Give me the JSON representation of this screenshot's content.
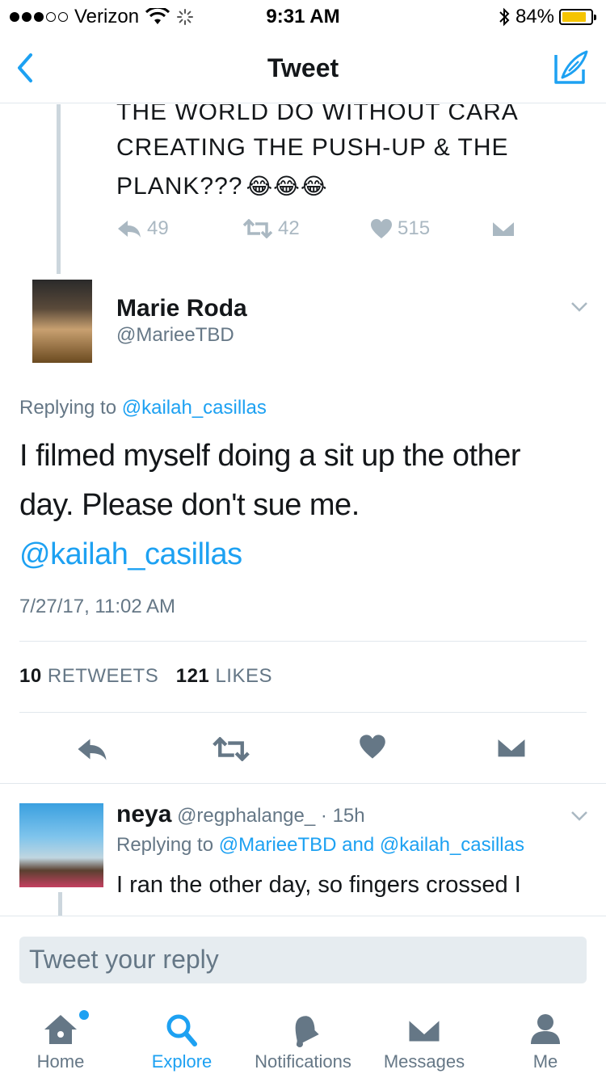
{
  "status_bar": {
    "carrier": "Verizon",
    "time": "9:31 AM",
    "battery_percent": "84%",
    "battery_level": 0.84,
    "icons": [
      "signal-dots-icon",
      "wifi-icon",
      "activity-spinner-icon",
      "bluetooth-icon",
      "battery-icon"
    ]
  },
  "nav": {
    "title": "Tweet",
    "back_icon": "chevron-left-icon",
    "compose_icon": "compose-tweet-icon"
  },
  "previous_tweet": {
    "line1": "THE WORLD DO WITHOUT CARA",
    "line2": "CREATING THE PUSH-UP & THE",
    "line3": "PLANK???",
    "emojis": "😂😂😂",
    "replies": "49",
    "retweets": "42",
    "likes": "515"
  },
  "main_tweet": {
    "author_name": "Marie Roda",
    "author_handle": "@MarieeTBD",
    "replying_prefix": "Replying to",
    "replying_to": "@kailah_casillas",
    "text_line1": "I filmed myself doing a sit up the other",
    "text_line2": "day. Please don't sue me.",
    "mention": "@kailah_casillas",
    "timestamp": "7/27/17, 11:02 AM",
    "retweet_count": "10",
    "retweet_label": "RETWEETS",
    "like_count": "121",
    "like_label": "LIKES"
  },
  "reply": {
    "name": "neya",
    "handle": "@regphalange_",
    "time": "· 15h",
    "replying_prefix": "Replying to",
    "replying_to_1": "@MarieeTBD",
    "and": "and",
    "replying_to_2": "@kailah_casillas",
    "text": "I ran the other day, so fingers crossed I"
  },
  "compose": {
    "placeholder": "Tweet your reply"
  },
  "tabs": [
    {
      "label": "Home",
      "icon": "home-icon",
      "active": false
    },
    {
      "label": "Explore",
      "icon": "search-icon",
      "active": true
    },
    {
      "label": "Notifications",
      "icon": "bell-icon",
      "active": false
    },
    {
      "label": "Messages",
      "icon": "envelope-icon",
      "active": false
    },
    {
      "label": "Me",
      "icon": "person-icon",
      "active": false
    }
  ],
  "colors": {
    "accent": "#1da1f2",
    "text": "#14171a",
    "secondary": "#657786",
    "icon_gray": "#aab8c2",
    "battery": "#f5c400"
  }
}
